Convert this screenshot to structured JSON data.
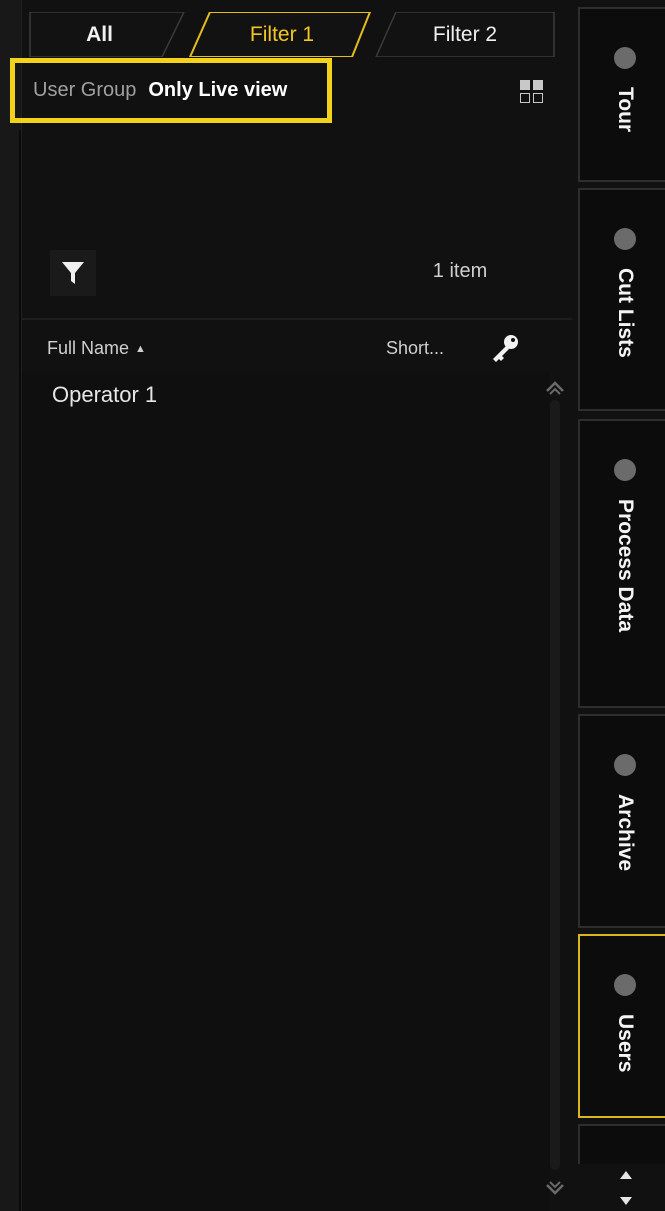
{
  "tabs": [
    {
      "label": "All",
      "active": false
    },
    {
      "label": "Filter 1",
      "active": true
    },
    {
      "label": "Filter 2",
      "active": false
    }
  ],
  "filter": {
    "label": "User Group",
    "value": "Only Live view"
  },
  "item_count": "1 item",
  "columns": {
    "full_name": "Full Name",
    "full_name_sort": "▲",
    "short": "Short..."
  },
  "rows": [
    {
      "full_name": "Operator 1"
    }
  ],
  "sidebar": {
    "items": [
      {
        "label": "Tour",
        "active": false
      },
      {
        "label": "Cut Lists",
        "active": false
      },
      {
        "label": "Process Data",
        "active": false
      },
      {
        "label": "Archive",
        "active": false
      },
      {
        "label": "Users",
        "active": true
      }
    ]
  },
  "colors": {
    "accent": "#f3c623",
    "highlight_border": "#f2d21a",
    "background": "#111111"
  },
  "icons": {
    "layout_toggle": "grid-view-icon",
    "filter": "funnel-icon",
    "key_column": "key-icon"
  }
}
